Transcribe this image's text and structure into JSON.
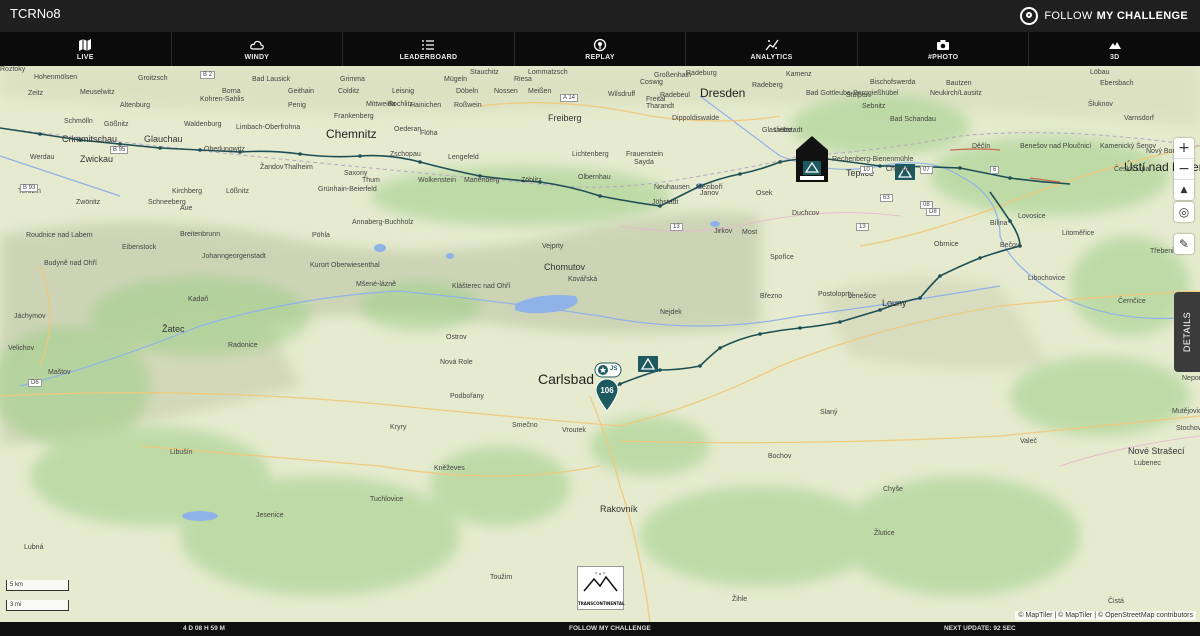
{
  "header": {
    "title": "TCRNo8",
    "brand": {
      "prefix": "FOLLOW",
      "suffix": "MY CHALLENGE"
    }
  },
  "nav": [
    {
      "label": "LIVE",
      "icon": "map-icon"
    },
    {
      "label": "WINDY",
      "icon": "cloud-icon"
    },
    {
      "label": "LEADERBOARD",
      "icon": "list-icon"
    },
    {
      "label": "REPLAY",
      "icon": "replay-icon"
    },
    {
      "label": "ANALYTICS",
      "icon": "analytics-icon"
    },
    {
      "label": "#PHOTO",
      "icon": "camera-icon"
    },
    {
      "label": "3D",
      "icon": "mountain-icon"
    }
  ],
  "map": {
    "places": [
      {
        "t": "Hohenmölsen",
        "c": "s"
      },
      {
        "t": "Groitzsch",
        "c": "s"
      },
      {
        "t": "Bad Lausick",
        "c": "s"
      },
      {
        "t": "Grimma",
        "c": "s"
      },
      {
        "t": "Mügeln",
        "c": "s"
      },
      {
        "t": "Riesa",
        "c": "s"
      },
      {
        "t": "Stauchitz",
        "c": "s"
      },
      {
        "t": "Lommatzsch",
        "c": "s"
      },
      {
        "t": "Großenhain",
        "c": "s"
      },
      {
        "t": "Radeburg",
        "c": "s"
      },
      {
        "t": "Kamenz",
        "c": "s"
      },
      {
        "t": "Bischofswerda",
        "c": "s"
      },
      {
        "t": "Bautzen",
        "c": "s"
      },
      {
        "t": "Löbau",
        "c": "s"
      },
      {
        "t": "Zeitz",
        "c": "s"
      },
      {
        "t": "Meuselwitz",
        "c": "s"
      },
      {
        "t": "Borna",
        "c": "s"
      },
      {
        "t": "Geithain",
        "c": "s"
      },
      {
        "t": "Colditz",
        "c": "s"
      },
      {
        "t": "Leisnig",
        "c": "s"
      },
      {
        "t": "Döbeln",
        "c": "s"
      },
      {
        "t": "Nossen",
        "c": "s"
      },
      {
        "t": "Meißen",
        "c": "s"
      },
      {
        "t": "Coswig",
        "c": "s"
      },
      {
        "t": "Radebeul",
        "c": "s"
      },
      {
        "t": "Radeberg",
        "c": "s"
      },
      {
        "t": "Neukirch/Lausitz",
        "c": "s"
      },
      {
        "t": "Ebersbach",
        "c": "s"
      },
      {
        "t": "Altenburg",
        "c": "s"
      },
      {
        "t": "Kohren-Sahlis",
        "c": "s"
      },
      {
        "t": "Penig",
        "c": "s"
      },
      {
        "t": "Rochlitz",
        "c": "s"
      },
      {
        "t": "Mittweida",
        "c": "s"
      },
      {
        "t": "Hainichen",
        "c": "s"
      },
      {
        "t": "Roßwein",
        "c": "s"
      },
      {
        "t": "Wilsdruff",
        "c": "s"
      },
      {
        "t": "Freital",
        "c": "s"
      },
      {
        "t": "Tharandt",
        "c": "s"
      },
      {
        "t": "Dresden",
        "c": "l"
      },
      {
        "t": "Stolpen",
        "c": "s"
      },
      {
        "t": "Šluknov",
        "c": "s"
      },
      {
        "t": "Schmölln",
        "c": "s"
      },
      {
        "t": "Gößnitz",
        "c": "s"
      },
      {
        "t": "Waldenburg",
        "c": "s"
      },
      {
        "t": "Limbach-Oberfrohna",
        "c": "s"
      },
      {
        "t": "Frankenberg",
        "c": "s"
      },
      {
        "t": "Oederan",
        "c": "s"
      },
      {
        "t": "Freiberg",
        "c": "m"
      },
      {
        "t": "Dippoldiswalde",
        "c": "s"
      },
      {
        "t": "Bad Gottleuba-Berggießhübel",
        "c": "s"
      },
      {
        "t": "Sebnitz",
        "c": "s"
      },
      {
        "t": "Bad Schandau",
        "c": "s"
      },
      {
        "t": "Varnsdorf",
        "c": "s"
      },
      {
        "t": "Crimmitschau",
        "c": "m"
      },
      {
        "t": "Glauchau",
        "c": "m"
      },
      {
        "t": "Chemnitz",
        "c": "l"
      },
      {
        "t": "Flöha",
        "c": "s"
      },
      {
        "t": "Glashütte",
        "c": "s"
      },
      {
        "t": "Liebstadt",
        "c": "s"
      },
      {
        "t": "Děčín",
        "c": "s"
      },
      {
        "t": "Benešov nad Ploučnicí",
        "c": "s"
      },
      {
        "t": "Kamenický Šenov",
        "c": "s"
      },
      {
        "t": "Nový Bor",
        "c": "s"
      },
      {
        "t": "Werdau",
        "c": "s"
      },
      {
        "t": "Zwickau",
        "c": "m"
      },
      {
        "t": "Oberlungwitz",
        "c": "s"
      },
      {
        "t": "Zschopau",
        "c": "s"
      },
      {
        "t": "Lengefeld",
        "c": "s"
      },
      {
        "t": "Lichtenberg",
        "c": "s"
      },
      {
        "t": "Frauenstein",
        "c": "s"
      },
      {
        "t": "Sayda",
        "c": "s"
      },
      {
        "t": "Rechenberg-Bienenmühle",
        "c": "s"
      },
      {
        "t": "Teplice",
        "c": "m"
      },
      {
        "t": "Chlumec",
        "c": "s"
      },
      {
        "t": "Ústí nad Labem",
        "c": "l"
      },
      {
        "t": "Česká Lípa",
        "c": "s"
      },
      {
        "t": "Žandov",
        "c": "s"
      },
      {
        "t": "Thalheim",
        "c": "s"
      },
      {
        "t": "Saxony",
        "c": "s"
      },
      {
        "t": "Thum",
        "c": "s"
      },
      {
        "t": "Wolkenstein",
        "c": "s"
      },
      {
        "t": "Marienberg",
        "c": "s"
      },
      {
        "t": "Zöblitz",
        "c": "s"
      },
      {
        "t": "Olbernhau",
        "c": "s"
      },
      {
        "t": "Neuhausen",
        "c": "s"
      },
      {
        "t": "Meziboří",
        "c": "s"
      },
      {
        "t": "Osek",
        "c": "s"
      },
      {
        "t": "Duchcov",
        "c": "s"
      },
      {
        "t": "Bílina",
        "c": "s"
      },
      {
        "t": "Lovosice",
        "c": "s"
      },
      {
        "t": "Litoměřice",
        "c": "s"
      },
      {
        "t": "Terezín",
        "c": "s"
      },
      {
        "t": "Kirchberg",
        "c": "s"
      },
      {
        "t": "Lößnitz",
        "c": "s"
      },
      {
        "t": "Zwönitz",
        "c": "s"
      },
      {
        "t": "Schneeberg",
        "c": "s"
      },
      {
        "t": "Aue",
        "c": "s"
      },
      {
        "t": "Grünhain-Beierfeld",
        "c": "s"
      },
      {
        "t": "Annaberg-Buchholz",
        "c": "s"
      },
      {
        "t": "Jöhstadt",
        "c": "s"
      },
      {
        "t": "Janov",
        "c": "s"
      },
      {
        "t": "Jirkov",
        "c": "s"
      },
      {
        "t": "Most",
        "c": "s"
      },
      {
        "t": "Obrnice",
        "c": "s"
      },
      {
        "t": "Třebenice",
        "c": "s"
      },
      {
        "t": "Roudnice nad Labem",
        "c": "s"
      },
      {
        "t": "Eibenstock",
        "c": "s"
      },
      {
        "t": "Breitenbrunn",
        "c": "s"
      },
      {
        "t": "Pöhla",
        "c": "s"
      },
      {
        "t": "Vejprty",
        "c": "s"
      },
      {
        "t": "Chomutov",
        "c": "m"
      },
      {
        "t": "Spořice",
        "c": "s"
      },
      {
        "t": "Bečov",
        "c": "s"
      },
      {
        "t": "Libochovice",
        "c": "s"
      },
      {
        "t": "Budyně nad Ohří",
        "c": "s"
      },
      {
        "t": "Johanngeorgenstadt",
        "c": "s"
      },
      {
        "t": "Kurort Oberwiesenthal",
        "c": "s"
      },
      {
        "t": "Kovářská",
        "c": "s"
      },
      {
        "t": "Březno",
        "c": "s"
      },
      {
        "t": "Postoloprty",
        "c": "s"
      },
      {
        "t": "Lenešice",
        "c": "s"
      },
      {
        "t": "Louny",
        "c": "m"
      },
      {
        "t": "Černčice",
        "c": "s"
      },
      {
        "t": "Mšené-lázně",
        "c": "s"
      },
      {
        "t": "Klášterec nad Ohří",
        "c": "s"
      },
      {
        "t": "Kadaň",
        "c": "s"
      },
      {
        "t": "Jáchymov",
        "c": "s"
      },
      {
        "t": "Nejdek",
        "c": "s"
      },
      {
        "t": "Žatec",
        "c": "m"
      },
      {
        "t": "Ostrov",
        "c": "s"
      },
      {
        "t": "Radonice",
        "c": "s"
      },
      {
        "t": "Velichov",
        "c": "s"
      },
      {
        "t": "Nová Role",
        "c": "s"
      },
      {
        "t": "Maštov",
        "c": "s"
      },
      {
        "t": "Carlsbad",
        "c": "xl"
      },
      {
        "t": "Podbořany",
        "c": "s"
      },
      {
        "t": "Nepomyšl",
        "c": "s"
      },
      {
        "t": "Slaný",
        "c": "s"
      },
      {
        "t": "Mutějovice",
        "c": "s"
      },
      {
        "t": "Smečno",
        "c": "s"
      },
      {
        "t": "Vroutek",
        "c": "s"
      },
      {
        "t": "Kryry",
        "c": "s"
      },
      {
        "t": "Valeč",
        "c": "s"
      },
      {
        "t": "Nové Strašecí",
        "c": "m"
      },
      {
        "t": "Stochov",
        "c": "s"
      },
      {
        "t": "Libušín",
        "c": "s"
      },
      {
        "t": "Bochov",
        "c": "s"
      },
      {
        "t": "Kněževes",
        "c": "s"
      },
      {
        "t": "Lubenec",
        "c": "s"
      },
      {
        "t": "Tuchlovice",
        "c": "s"
      },
      {
        "t": "Chyše",
        "c": "s"
      },
      {
        "t": "Rakovník",
        "c": "m"
      },
      {
        "t": "Jesenice",
        "c": "s"
      },
      {
        "t": "Žlutice",
        "c": "s"
      },
      {
        "t": "Lubná",
        "c": "s"
      },
      {
        "t": "Toužim",
        "c": "s"
      },
      {
        "t": "Žihle",
        "c": "s"
      },
      {
        "t": "Čistá",
        "c": "s"
      },
      {
        "t": "Roztoky",
        "c": "s"
      }
    ],
    "roads": [
      "B 2",
      "B 95",
      "B 93",
      "A 14",
      "13",
      "13",
      "63",
      "08",
      "D8",
      "D6",
      "07",
      "6",
      "10"
    ],
    "rider_marker": "106",
    "rider_badge": "JS",
    "controls": {
      "zoom_in": "+",
      "zoom_out": "−",
      "compass": "▲",
      "locate": "◎",
      "layers": "✎"
    },
    "details_label": "DETAILS",
    "scale": {
      "metric": "5 km",
      "imperial": "3 mi"
    },
    "attribution": "© MapTiler | © MapTiler | © OpenStreetMap contributors",
    "logo_text": "TRANSCONTINENTAL"
  },
  "footer": {
    "elapsed": "4 D 08 H 59 M",
    "center": "FOLLOW MY CHALLENGE",
    "next_update": "NEXT UPDATE: 92 SEC"
  }
}
